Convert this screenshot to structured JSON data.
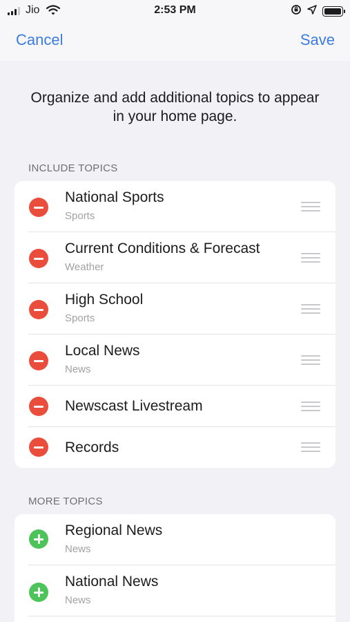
{
  "status": {
    "carrier": "Jio",
    "time": "2:53 PM"
  },
  "nav": {
    "cancel": "Cancel",
    "save": "Save"
  },
  "intro": "Organize and add additional topics to appear in your home page.",
  "include_header": "INCLUDE TOPICS",
  "include_topics": [
    {
      "title": "National Sports",
      "subtitle": "Sports"
    },
    {
      "title": "Current Conditions & Forecast",
      "subtitle": "Weather"
    },
    {
      "title": "High School",
      "subtitle": "Sports"
    },
    {
      "title": "Local News",
      "subtitle": "News"
    },
    {
      "title": "Newscast Livestream",
      "subtitle": ""
    },
    {
      "title": "Records",
      "subtitle": ""
    }
  ],
  "more_header": "MORE TOPICS",
  "more_topics": [
    {
      "title": "Regional News",
      "subtitle": "News"
    },
    {
      "title": "National News",
      "subtitle": "News"
    }
  ],
  "colors": {
    "accent": "#3b7ce0",
    "remove": "#eb4d3d",
    "add": "#4cc45a"
  }
}
